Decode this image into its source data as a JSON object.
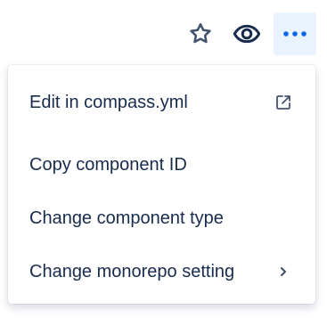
{
  "toolbar": {
    "buttons": [
      {
        "name": "star",
        "icon": "star-icon"
      },
      {
        "name": "watch",
        "icon": "eye-icon"
      },
      {
        "name": "more",
        "icon": "more-dots-icon",
        "active": true
      }
    ]
  },
  "menu": {
    "items": [
      {
        "label": "Edit in compass.yml",
        "trailing_icon": "external-link-icon"
      },
      {
        "label": "Copy component ID"
      },
      {
        "label": "Change component type"
      },
      {
        "label": "Change monorepo setting",
        "trailing_icon": "chevron-right-icon"
      }
    ]
  },
  "colors": {
    "text": "#172b4d",
    "icon": "#44546f",
    "accent": "#0c66e4",
    "active_bg": "#e9f2ff"
  }
}
